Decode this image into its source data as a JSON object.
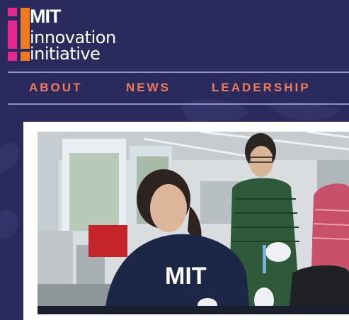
{
  "logo": {
    "mark_text": "MIT",
    "line1": "innovation",
    "line2": "initiative",
    "colors": {
      "pink": "#e8288c",
      "orange": "#f07a1e",
      "white": "#ffffff"
    }
  },
  "nav": {
    "items": [
      {
        "label": "ABOUT"
      },
      {
        "label": "NEWS"
      },
      {
        "label": "LEADERSHIP"
      }
    ]
  },
  "hero": {
    "image": "lab-photo",
    "shirt_text": "MIT"
  },
  "colors": {
    "background": "#2b2a5c",
    "nav_text": "#f07a5c",
    "rule": "#8e8fc4",
    "card": "#ffffff"
  }
}
